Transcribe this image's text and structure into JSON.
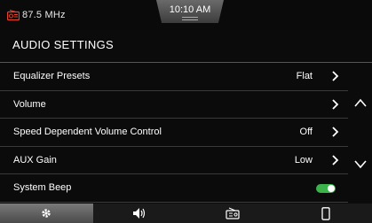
{
  "status": {
    "station": "87.5 MHz",
    "clock": "10:10 AM",
    "radio_icon": "radio-icon"
  },
  "header": {
    "title": "AUDIO SETTINGS"
  },
  "settings": [
    {
      "label": "Equalizer Presets",
      "value": "Flat",
      "control": "chevron"
    },
    {
      "label": "Volume",
      "value": "",
      "control": "chevron"
    },
    {
      "label": "Speed Dependent Volume Control",
      "value": "Off",
      "control": "chevron"
    },
    {
      "label": "AUX Gain",
      "value": "Low",
      "control": "chevron"
    },
    {
      "label": "System Beep",
      "value": "",
      "control": "toggle",
      "toggle_on": true
    }
  ],
  "scroll": {
    "up_icon": "chevron-up-icon",
    "down_icon": "chevron-down-icon"
  },
  "tabbar": {
    "tabs": [
      {
        "icon": "gear-icon",
        "active": true
      },
      {
        "icon": "speaker-icon",
        "active": false
      },
      {
        "icon": "radio-icon",
        "active": false
      },
      {
        "icon": "phone-icon",
        "active": false
      }
    ]
  },
  "colors": {
    "toggle_on": "#3cb34a",
    "accent_red": "#e8412c"
  }
}
